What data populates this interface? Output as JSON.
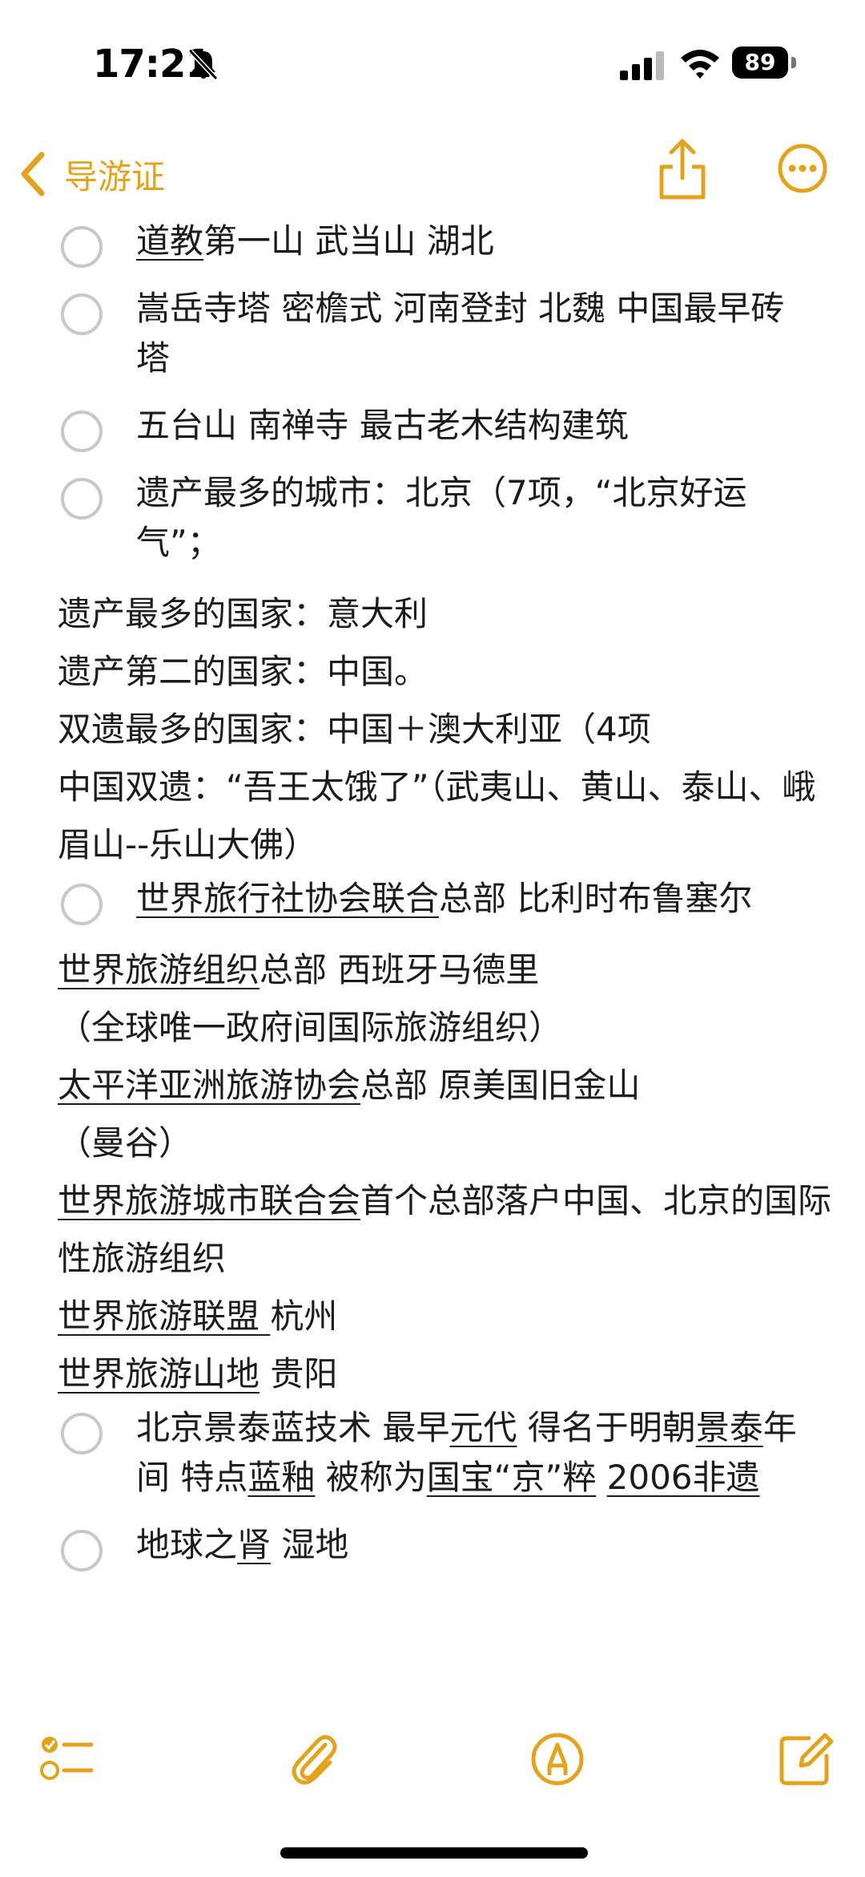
{
  "status": {
    "time": "17:21",
    "battery": "89"
  },
  "nav": {
    "back_label": "导游证"
  },
  "items": [
    {
      "type": "check",
      "parts": [
        {
          "t": "道教",
          "u": true
        },
        {
          "t": "第一山 武当山 湖北"
        }
      ]
    },
    {
      "type": "check",
      "parts": [
        {
          "t": "嵩岳寺塔 密檐式 河南登封 北魏 中国最早砖塔"
        }
      ]
    },
    {
      "type": "check",
      "parts": [
        {
          "t": "五台山 南禅寺 最古老木结构建筑"
        }
      ]
    },
    {
      "type": "check",
      "parts": [
        {
          "t": "遗产最多的城市：北京（7项，“北京好运气”；"
        }
      ]
    },
    {
      "type": "para",
      "parts": [
        {
          "t": "遗产最多的国家：意大利"
        }
      ]
    },
    {
      "type": "para",
      "parts": [
        {
          "t": "遗产第二的国家：中国。"
        }
      ]
    },
    {
      "type": "para",
      "parts": [
        {
          "t": "双遗最多的国家：中国＋澳大利亚（4项"
        }
      ]
    },
    {
      "type": "para",
      "parts": [
        {
          "t": "中国双遗：“吾王太饿了”（武夷山、黄山、泰山、峨眉山--乐山大佛）"
        }
      ]
    },
    {
      "type": "check",
      "parts": [
        {
          "t": "世界旅行社协会联合",
          "u": true
        },
        {
          "t": "总部 比利时布鲁塞尔"
        }
      ]
    },
    {
      "type": "para",
      "parts": [
        {
          "t": "世界旅游组织",
          "u": true
        },
        {
          "t": "总部 西班牙马德里"
        }
      ]
    },
    {
      "type": "para",
      "parts": [
        {
          "t": "（全球唯一政府间国际旅游组织）"
        }
      ]
    },
    {
      "type": "para",
      "parts": [
        {
          "t": "太平洋亚洲旅游协会",
          "u": true
        },
        {
          "t": "总部 原美国旧金山"
        }
      ]
    },
    {
      "type": "para",
      "parts": [
        {
          "t": "（曼谷）"
        }
      ]
    },
    {
      "type": "para",
      "parts": [
        {
          "t": "世界旅游城市联合会",
          "u": true
        },
        {
          "t": "首个总部落户中国、北京的国际性旅游组织"
        }
      ]
    },
    {
      "type": "para",
      "parts": [
        {
          "t": "世界旅游联盟 ",
          "u": true
        },
        {
          "t": "杭州"
        }
      ]
    },
    {
      "type": "para",
      "parts": [
        {
          "t": "世界旅游山地",
          "u": true
        },
        {
          "t": " 贵阳"
        }
      ]
    },
    {
      "type": "check",
      "parts": [
        {
          "t": "北京景泰蓝技术 最早"
        },
        {
          "t": "元代",
          "u": true
        },
        {
          "t": " 得名于明朝"
        },
        {
          "t": "景泰",
          "u": true
        },
        {
          "t": "年间 特点"
        },
        {
          "t": "蓝釉",
          "u": true
        },
        {
          "t": " 被称为"
        },
        {
          "t": "国宝“京”粹",
          "u": true
        },
        {
          "t": " "
        },
        {
          "t": "2006非遗",
          "u": true
        }
      ]
    },
    {
      "type": "check",
      "parts": [
        {
          "t": "地球之"
        },
        {
          "t": "肾",
          "u": true
        },
        {
          "t": " 湿地"
        }
      ]
    }
  ],
  "icons": {
    "back": "chevron-left-icon",
    "share": "share-icon",
    "more": "ellipsis-circle-icon",
    "checklist": "checklist-icon",
    "attach": "paperclip-icon",
    "markup": "pen-markup-icon",
    "compose": "compose-icon"
  },
  "colors": {
    "accent": "#e3a31c",
    "circle": "#c7c7cc",
    "text": "#1c1c1e"
  }
}
